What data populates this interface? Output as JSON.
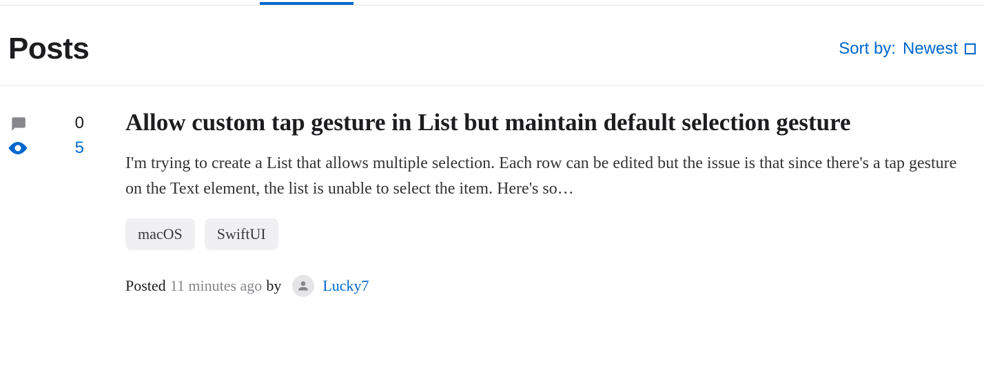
{
  "header": {
    "title": "Posts"
  },
  "sort": {
    "label": "Sort by:",
    "value": "Newest"
  },
  "post": {
    "stats": {
      "comments": "0",
      "views": "5"
    },
    "title": "Allow custom tap gesture in List but maintain default selection gesture",
    "excerpt": "I'm trying to create a List that allows multiple selection. Each row can be edited but the issue is that since there's a tap gesture on the Text element, the list is unable to select the item. Here's so…",
    "tags": [
      "macOS",
      "SwiftUI"
    ],
    "meta": {
      "posted_label": "Posted",
      "time": "11 minutes ago",
      "by_label": "by",
      "author": "Lucky7"
    }
  }
}
